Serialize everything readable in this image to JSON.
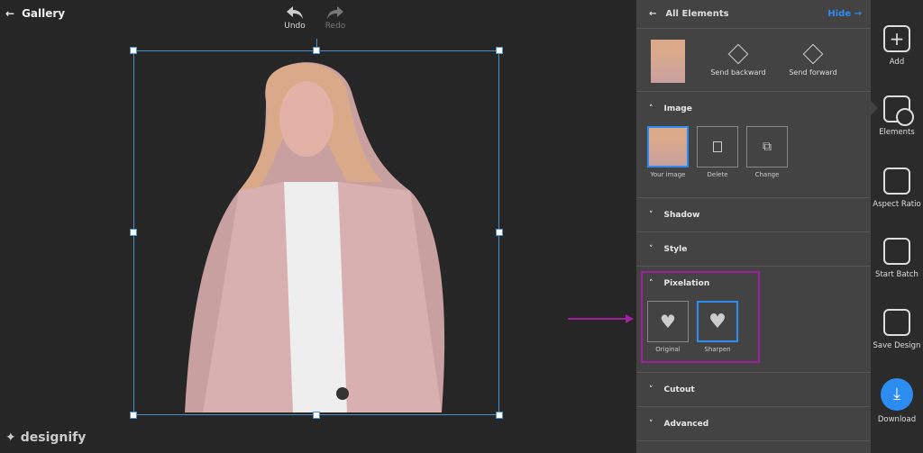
{
  "topbar": {
    "back_label": "Gallery",
    "undo_label": "Undo",
    "redo_label": "Redo"
  },
  "brand": {
    "name": "designify"
  },
  "panel": {
    "header": {
      "title": "All Elements",
      "hide_label": "Hide"
    },
    "layer": {
      "send_backward": "Send backward",
      "send_forward": "Send forward"
    },
    "sections": {
      "image": {
        "title": "Image",
        "tiles": [
          "Your image",
          "Delete",
          "Change"
        ]
      },
      "shadow": "Shadow",
      "style": "Style",
      "pixelation": {
        "title": "Pixelation",
        "options": [
          "Original",
          "Sharpen"
        ],
        "selected": "Sharpen"
      },
      "cutout": "Cutout",
      "advanced": "Advanced"
    }
  },
  "rail": {
    "items": [
      "Add",
      "Elements",
      "Aspect Ratio",
      "Start Batch",
      "Save Design",
      "Download"
    ]
  },
  "colors": {
    "accent": "#2d8cf0",
    "highlight": "#a020a0"
  }
}
